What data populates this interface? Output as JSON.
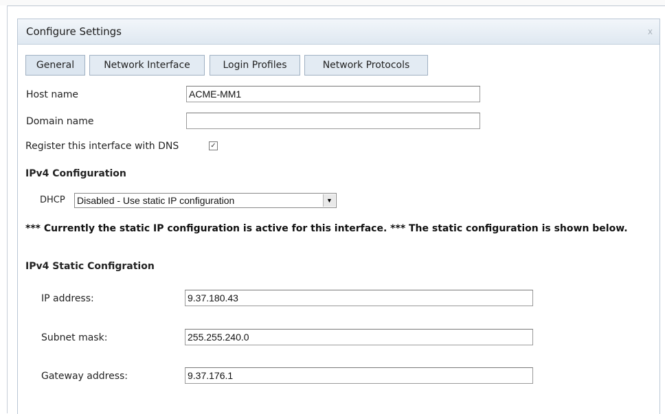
{
  "dialog": {
    "title": "Configure Settings",
    "close_label": "x"
  },
  "tabs": [
    {
      "label": "General"
    },
    {
      "label": "Network Interface"
    },
    {
      "label": "Login Profiles"
    },
    {
      "label": "Network Protocols"
    }
  ],
  "general": {
    "host_name_label": "Host name",
    "host_name_value": "ACME-MM1",
    "domain_name_label": "Domain name",
    "domain_name_value": "",
    "register_dns_label": "Register this interface with DNS",
    "register_dns_checked": true,
    "register_dns_mark": "✓"
  },
  "ipv4": {
    "section_title": "IPv4 Configuration",
    "dhcp_label": "DHCP",
    "dhcp_value": "Disabled - Use static IP configuration",
    "notice": "*** Currently the static IP configuration is active for this interface. *** The static configuration is shown below.",
    "static_title": "IPv4 Static Configration",
    "ip_label": "IP address:",
    "ip_value": "9.37.180.43",
    "subnet_label": "Subnet mask:",
    "subnet_value": "255.255.240.0",
    "gateway_label": "Gateway address:",
    "gateway_value": "9.37.176.1"
  }
}
